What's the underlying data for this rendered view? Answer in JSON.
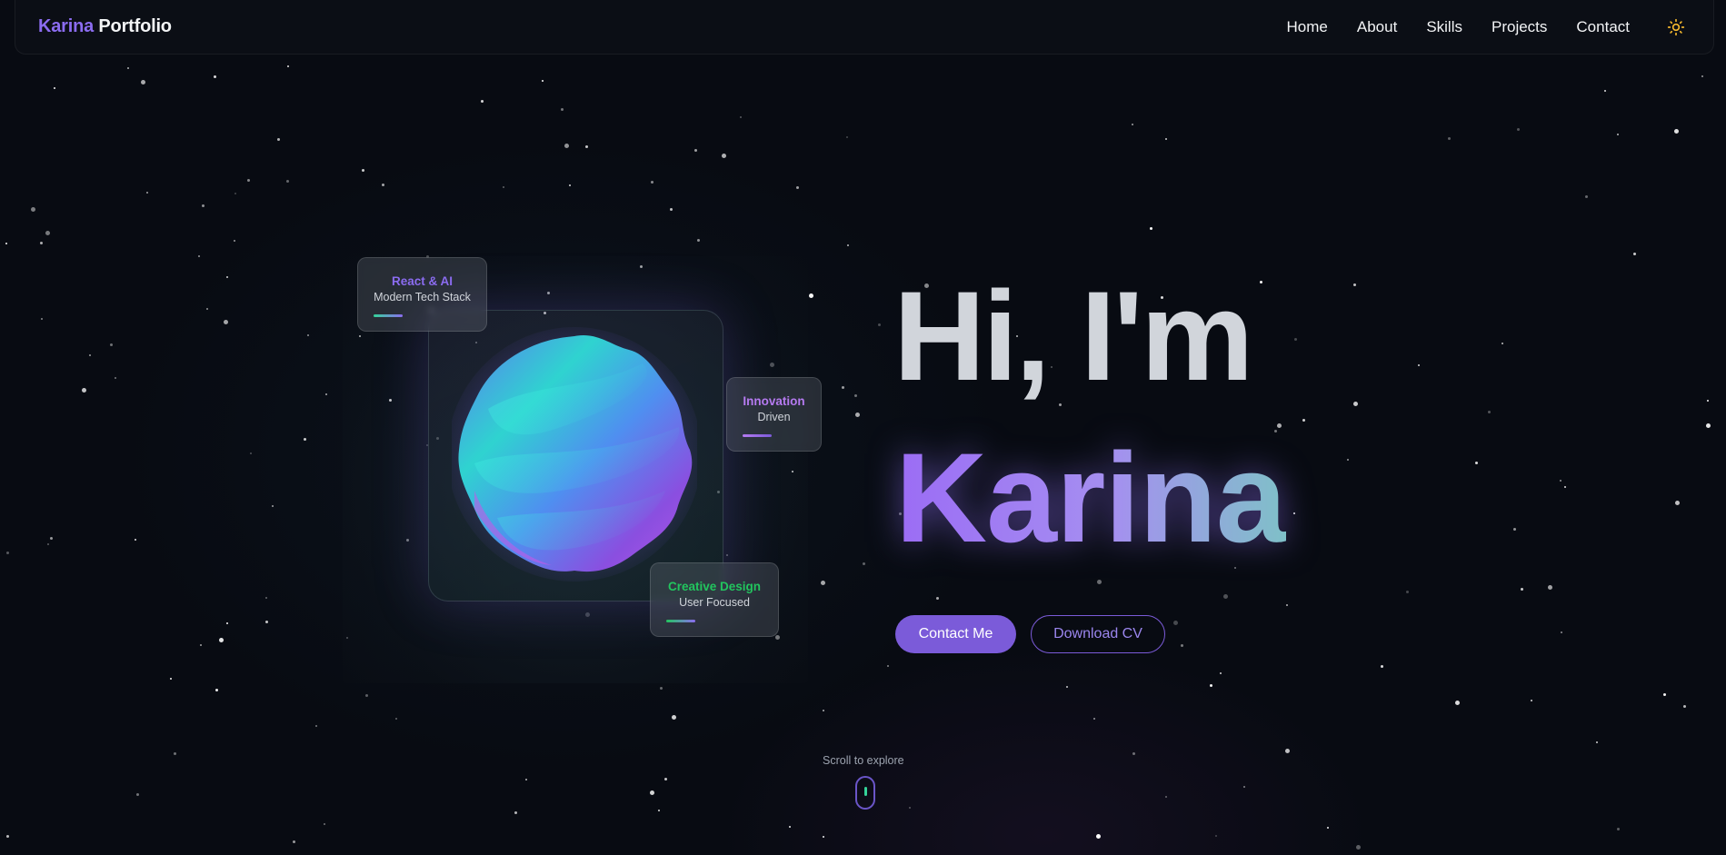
{
  "nav": {
    "brand_first": "Karina",
    "brand_second": "Portfolio",
    "links": [
      "Home",
      "About",
      "Skills",
      "Projects",
      "Contact"
    ],
    "theme_icon": "sun-icon"
  },
  "hero": {
    "greeting": "Hi, I'm",
    "name": "Karina",
    "primary_button": "Contact Me",
    "secondary_button": "Download CV"
  },
  "cards": [
    {
      "title": "React & AI",
      "subtitle": "Modern Tech Stack",
      "color": "#8b6cf0"
    },
    {
      "title": "Innovation",
      "subtitle": "Driven",
      "color": "#b57af0"
    },
    {
      "title": "Creative Design",
      "subtitle": "User Focused",
      "color": "#22c55e"
    }
  ],
  "scroll": {
    "label": "Scroll to explore"
  },
  "colors": {
    "accent": "#7b5bd9",
    "background": "#080b12",
    "green": "#22c55e"
  }
}
